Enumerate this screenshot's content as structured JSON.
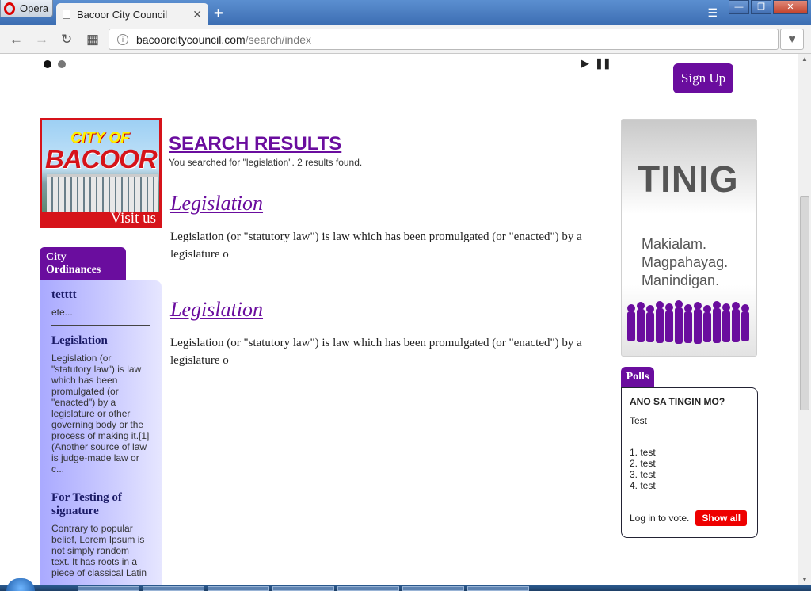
{
  "browser": {
    "menu_label": "Opera",
    "tab_title": "Bacoor City Council",
    "tab_close": "✕",
    "new_tab": "+",
    "url_domain": "bacoorcitycouncil.com",
    "url_path": "/search/index",
    "back": "←",
    "forward": "→",
    "reload": "↻",
    "speed_dial": "▦",
    "bookmark": "♥"
  },
  "slider": {
    "dots": 2,
    "active_dot": 0,
    "play": "▶",
    "pause": "❚❚"
  },
  "signup_label": "Sign Up",
  "banner": {
    "city_of": "CITY OF",
    "bacoor": "BACOOR",
    "visit": "Visit us"
  },
  "ordinances": {
    "tab_label": "City Ordinances",
    "items": [
      {
        "title": "tetttt",
        "text": "ete..."
      },
      {
        "title": "Legislation",
        "text": "Legislation (or \"statutory law\") is law which has been promulgated (or \"enacted\") by a legislature or other governing body or the process of making it.[1] (Another source of law is judge-made law or c..."
      },
      {
        "title": "For Testing of signature",
        "text": "Contrary to popular belief, Lorem Ipsum is not simply random text. It has roots in a piece of classical Latin"
      }
    ]
  },
  "search": {
    "heading": "SEARCH RESULTS",
    "summary": "You searched for \"legislation\". 2 results found.",
    "results": [
      {
        "title": "Legislation",
        "snippet": "Legislation (or \"statutory law\") is law which has been promulgated (or \"enacted\") by a legislature o"
      },
      {
        "title": "Legislation",
        "snippet": "Legislation (or \"statutory law\") is law which has been promulgated (or \"enacted\") by a legislature o"
      }
    ]
  },
  "tinig": {
    "title": "TINIG",
    "line1": "Makialam.",
    "line2": "Magpahayag.",
    "line3": "Manindigan."
  },
  "polls": {
    "tab_label": "Polls",
    "question": "ANO SA TINGIN MO?",
    "description": "Test",
    "options": [
      "1. test",
      "2. test",
      "3. test",
      "4. test"
    ],
    "login_text": "Log in to vote.",
    "show_all": "Show all"
  },
  "colors": {
    "brand_purple": "#6a0d9e",
    "banner_red": "#d6131a",
    "show_all_red": "#e00000"
  }
}
